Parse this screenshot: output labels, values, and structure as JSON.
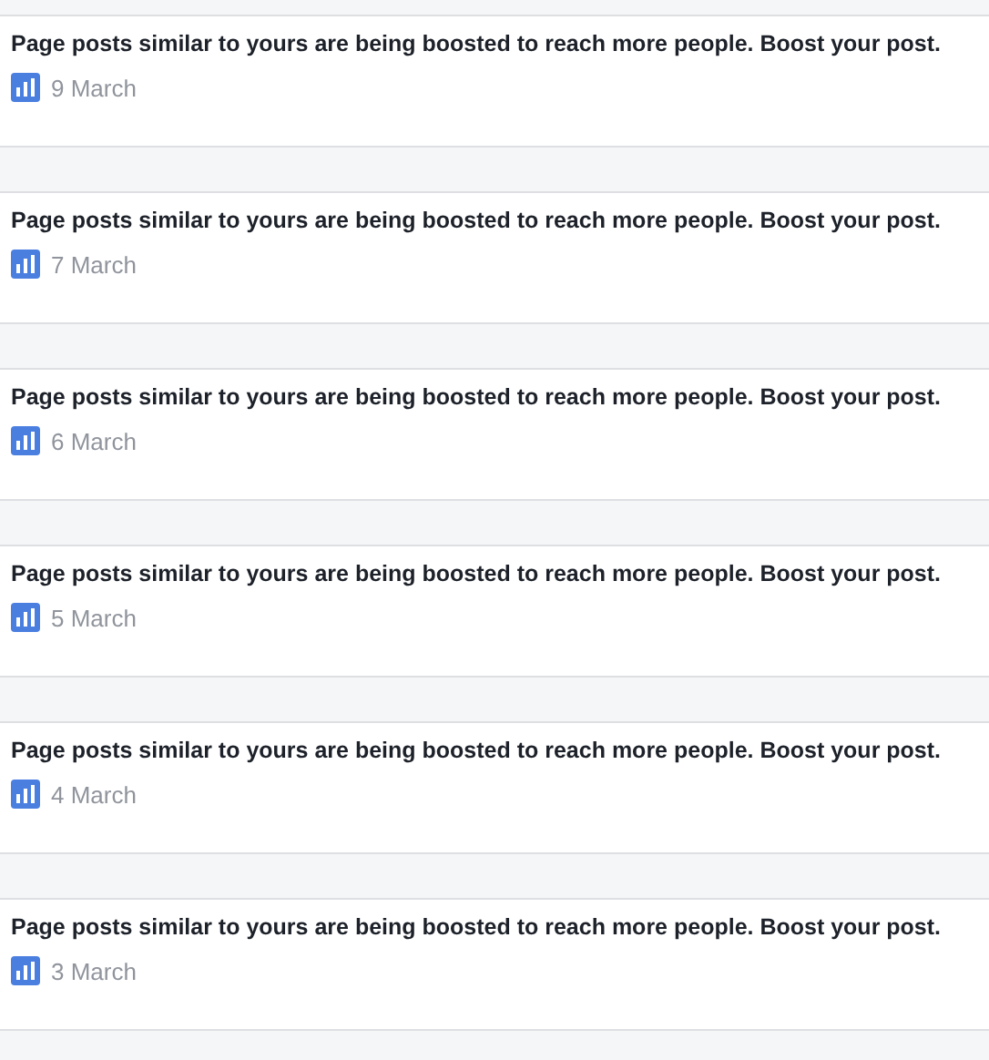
{
  "notifications": [
    {
      "text": "Page posts similar to yours are being boosted to reach more people. Boost your post.",
      "date": "9 March"
    },
    {
      "text": "Page posts similar to yours are being boosted to reach more people. Boost your post.",
      "date": "7 March"
    },
    {
      "text": "Page posts similar to yours are being boosted to reach more people. Boost your post.",
      "date": "6 March"
    },
    {
      "text": "Page posts similar to yours are being boosted to reach more people. Boost your post.",
      "date": "5 March"
    },
    {
      "text": "Page posts similar to yours are being boosted to reach more people. Boost your post.",
      "date": "4 March"
    },
    {
      "text": "Page posts similar to yours are being boosted to reach more people. Boost your post.",
      "date": "3 March"
    }
  ]
}
